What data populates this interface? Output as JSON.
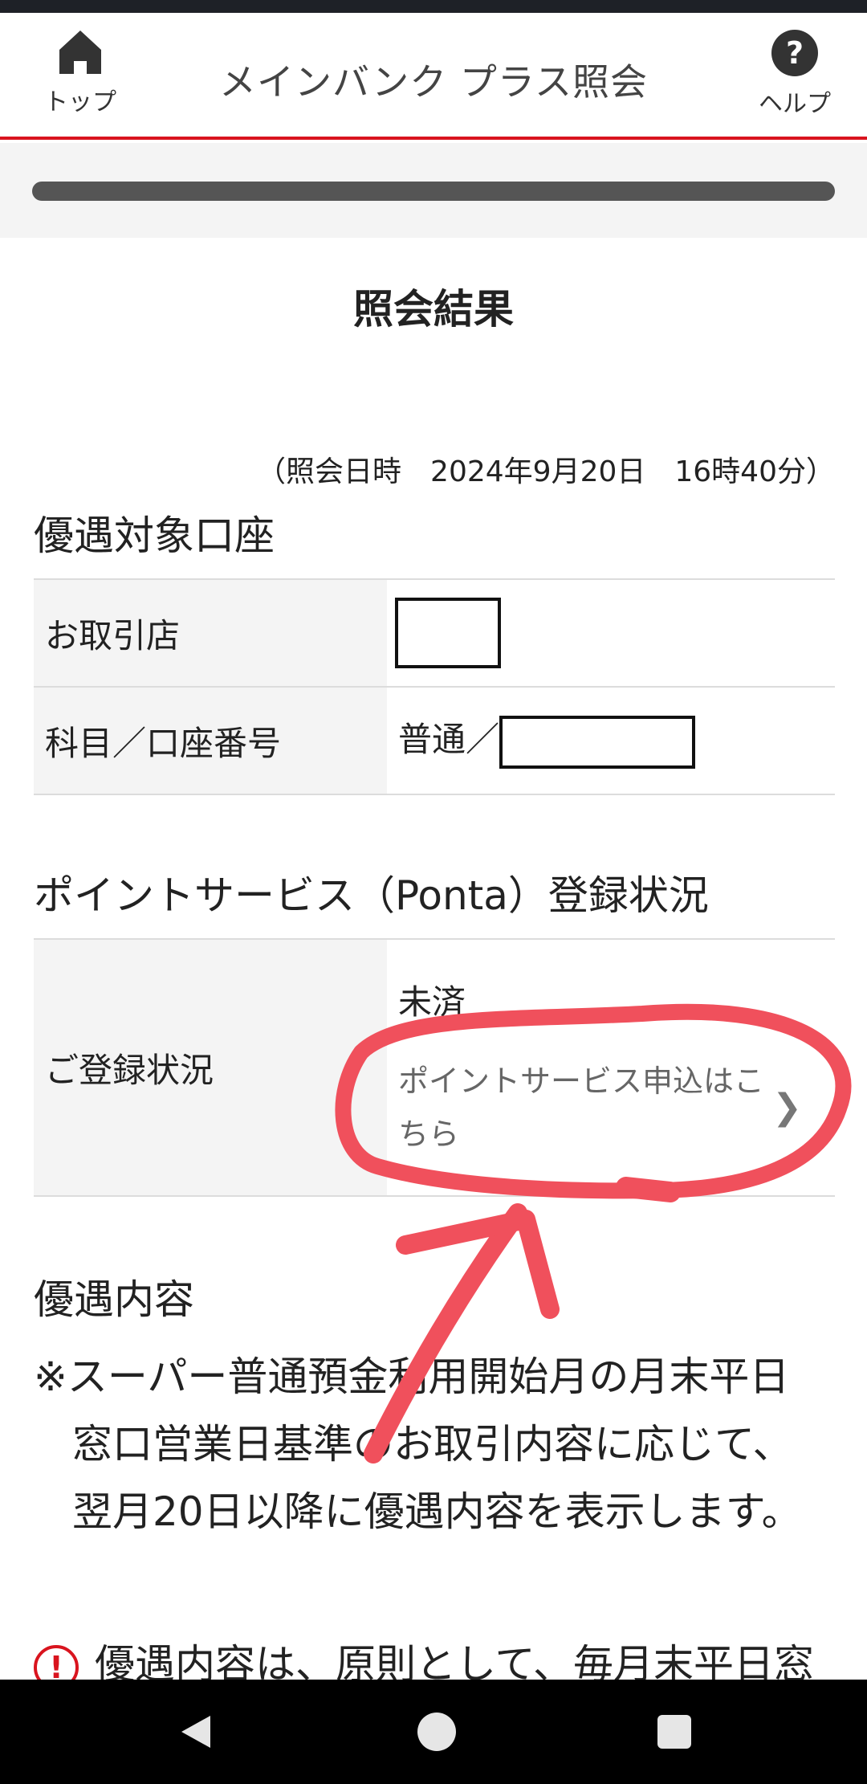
{
  "header": {
    "top_label": "トップ",
    "title": "メインバンク プラス照会",
    "help_label": "ヘルプ",
    "icons": [
      "home-icon",
      "help-icon"
    ],
    "accent_color": "#d9141e"
  },
  "page": {
    "title": "照会結果",
    "datetime": "（照会日時　2024年9月20日　16時40分）"
  },
  "account_section": {
    "heading": "優遇対象口座",
    "rows": [
      {
        "label": "お取引店",
        "value": ""
      },
      {
        "label": "科目／口座番号",
        "value": "普通／"
      }
    ]
  },
  "point_section": {
    "heading": "ポイントサービス（Ponta）登録状況",
    "label": "ご登録状況",
    "status": "未済",
    "apply_link": "ポイントサービス申込はこちら"
  },
  "benefit_section": {
    "heading": "優遇内容",
    "note_lines": [
      "※スーパー普通預金利用開始月の月末平日",
      "窓口営業日基準のお取引内容に応じて、",
      "翌月20日以降に優遇内容を表示します。"
    ],
    "warning": "優遇内容は、原則として、毎月末平日窓"
  },
  "annotation": {
    "color": "#f0505c"
  },
  "navbar": {
    "icons": [
      "back-icon",
      "home-circle-icon",
      "recents-icon"
    ]
  }
}
